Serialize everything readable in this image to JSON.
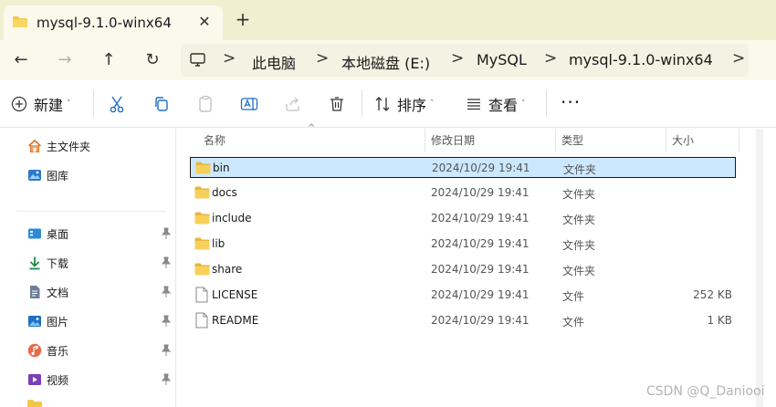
{
  "tab": {
    "title": "mysql-9.1.0-winx64",
    "close": "✕",
    "new_tab": "+"
  },
  "nav": {
    "back": "←",
    "forward": "→",
    "up": "↑",
    "refresh": "↻"
  },
  "address": {
    "separator": ">",
    "crumbs": [
      "此电脑",
      "本地磁盘 (E:)",
      "MySQL",
      "mysql-9.1.0-winx64"
    ]
  },
  "toolbar": {
    "new_label": "新建",
    "sort_label": "排序",
    "view_label": "查看",
    "more": "···",
    "caret": "˅"
  },
  "sidebar": {
    "top_items": [
      {
        "label": "主文件夹",
        "icon": "home-icon"
      },
      {
        "label": "图库",
        "icon": "gallery-icon"
      }
    ],
    "pinned_items": [
      {
        "label": "桌面",
        "icon": "desktop-icon"
      },
      {
        "label": "下载",
        "icon": "download-icon"
      },
      {
        "label": "文档",
        "icon": "document-icon"
      },
      {
        "label": "图片",
        "icon": "pictures-icon"
      },
      {
        "label": "音乐",
        "icon": "music-icon"
      },
      {
        "label": "视频",
        "icon": "video-icon"
      }
    ]
  },
  "columns": {
    "name": "名称",
    "date": "修改日期",
    "type": "类型",
    "size": "大小",
    "sort_indicator": "^"
  },
  "files": [
    {
      "name": "bin",
      "date": "2024/10/29 19:41",
      "type": "文件夹",
      "size": "",
      "icon": "folder-icon"
    },
    {
      "name": "docs",
      "date": "2024/10/29 19:41",
      "type": "文件夹",
      "size": "",
      "icon": "folder-icon"
    },
    {
      "name": "include",
      "date": "2024/10/29 19:41",
      "type": "文件夹",
      "size": "",
      "icon": "folder-icon"
    },
    {
      "name": "lib",
      "date": "2024/10/29 19:41",
      "type": "文件夹",
      "size": "",
      "icon": "folder-icon"
    },
    {
      "name": "share",
      "date": "2024/10/29 19:41",
      "type": "文件夹",
      "size": "",
      "icon": "folder-icon"
    },
    {
      "name": "LICENSE",
      "date": "2024/10/29 19:41",
      "type": "文件",
      "size": "252 KB",
      "icon": "file-icon"
    },
    {
      "name": "README",
      "date": "2024/10/29 19:41",
      "type": "文件",
      "size": "1 KB",
      "icon": "file-icon"
    }
  ],
  "selected_file": "bin",
  "watermark": "CSDN @Q_Daniooi",
  "colors": {
    "titlebar": "#f2efd0",
    "tab_active": "#fbf9ec",
    "selection": "#cce8ff",
    "folder": "#f2c84b",
    "accent": "#1f6fc4"
  }
}
